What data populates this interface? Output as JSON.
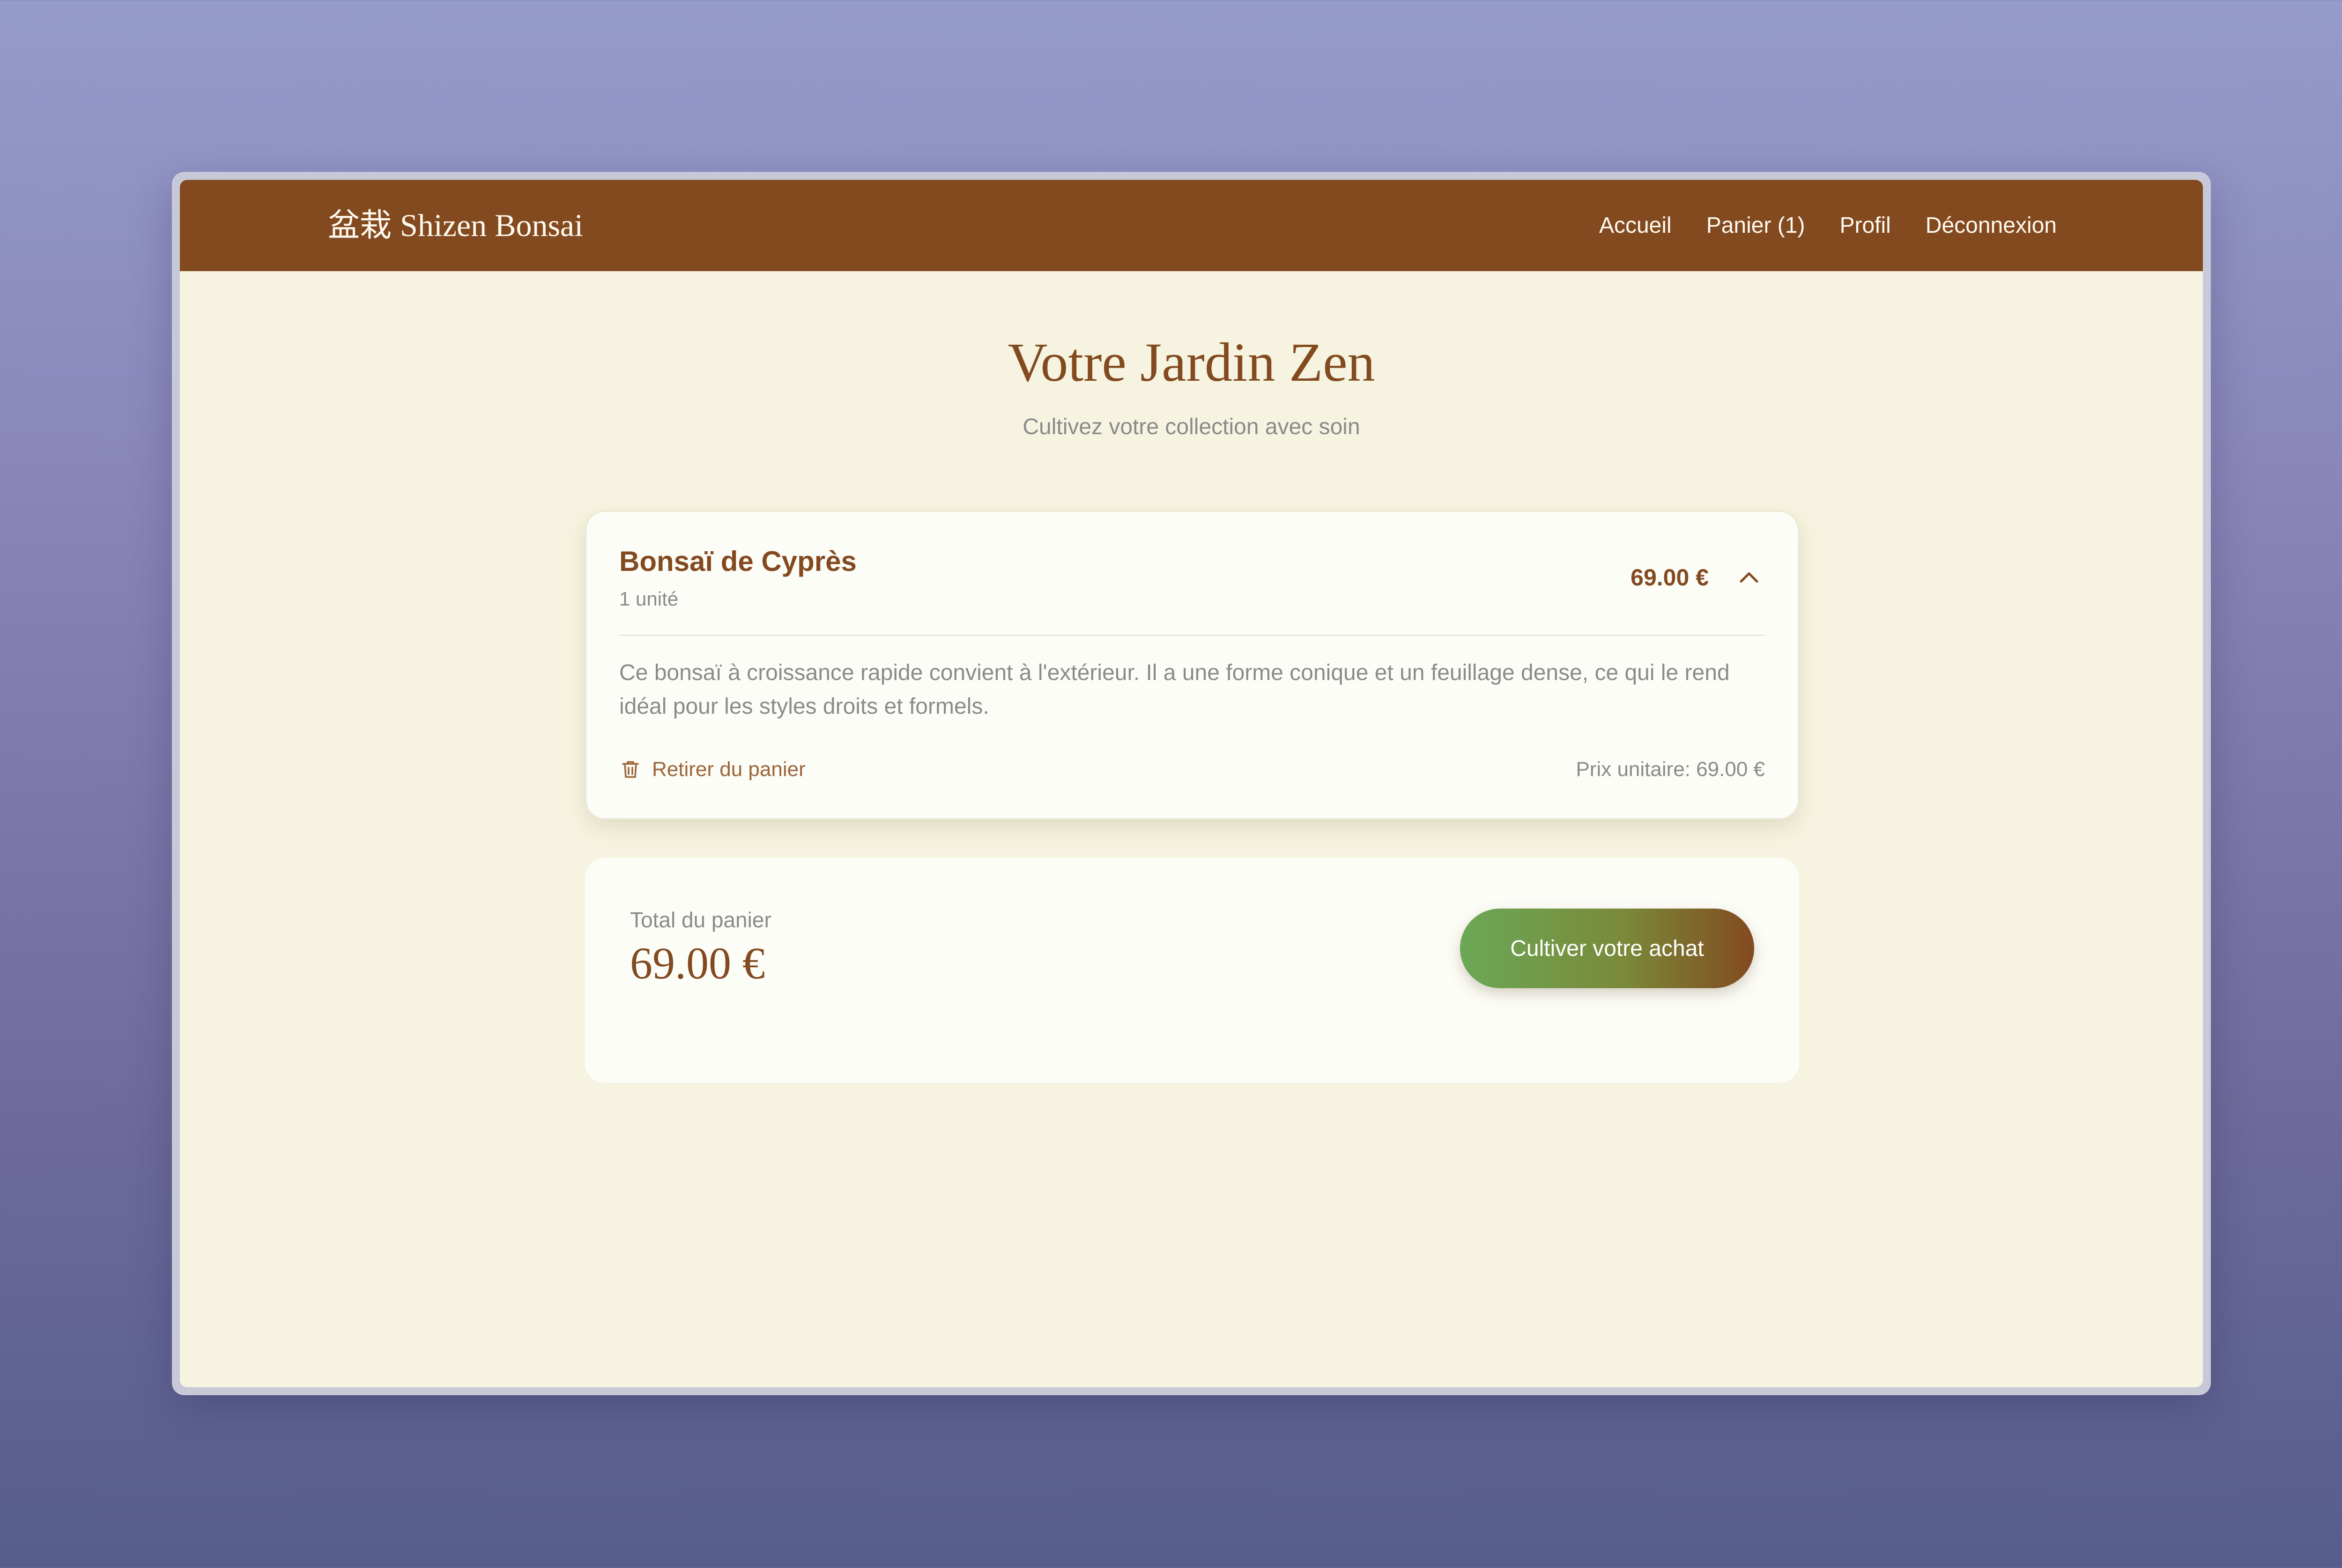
{
  "navbar": {
    "brand_kanji": "盆栽",
    "brand_name": "Shizen Bonsai",
    "links": [
      {
        "label": "Accueil"
      },
      {
        "label": "Panier (1)"
      },
      {
        "label": "Profil"
      },
      {
        "label": "Déconnexion"
      }
    ]
  },
  "header": {
    "title": "Votre Jardin Zen",
    "subtitle": "Cultivez votre collection avec soin"
  },
  "cart": {
    "items": [
      {
        "name": "Bonsaï de Cyprès",
        "quantity": "1 unité",
        "price": "69.00 €",
        "description": "Ce bonsaï à croissance rapide convient à l'extérieur. Il a une forme conique et un feuillage dense, ce qui le rend idéal pour les styles droits et formels.",
        "remove_label": "Retirer du panier",
        "unit_price": "Prix unitaire: 69.00 €",
        "expanded": true
      }
    ],
    "total_label": "Total du panier",
    "total_value": "69.00 €",
    "checkout_label": "Cultiver votre achat"
  },
  "colors": {
    "brand_brown": "#834a20",
    "page_background": "#f6f4e0",
    "card_background": "#fdfdf8",
    "muted_text": "#8a8a8a",
    "button_gradient_start": "#6aa856",
    "button_gradient_end": "#834a20"
  },
  "icons": {
    "collapse": "chevron-up-icon",
    "remove": "trash-icon"
  }
}
